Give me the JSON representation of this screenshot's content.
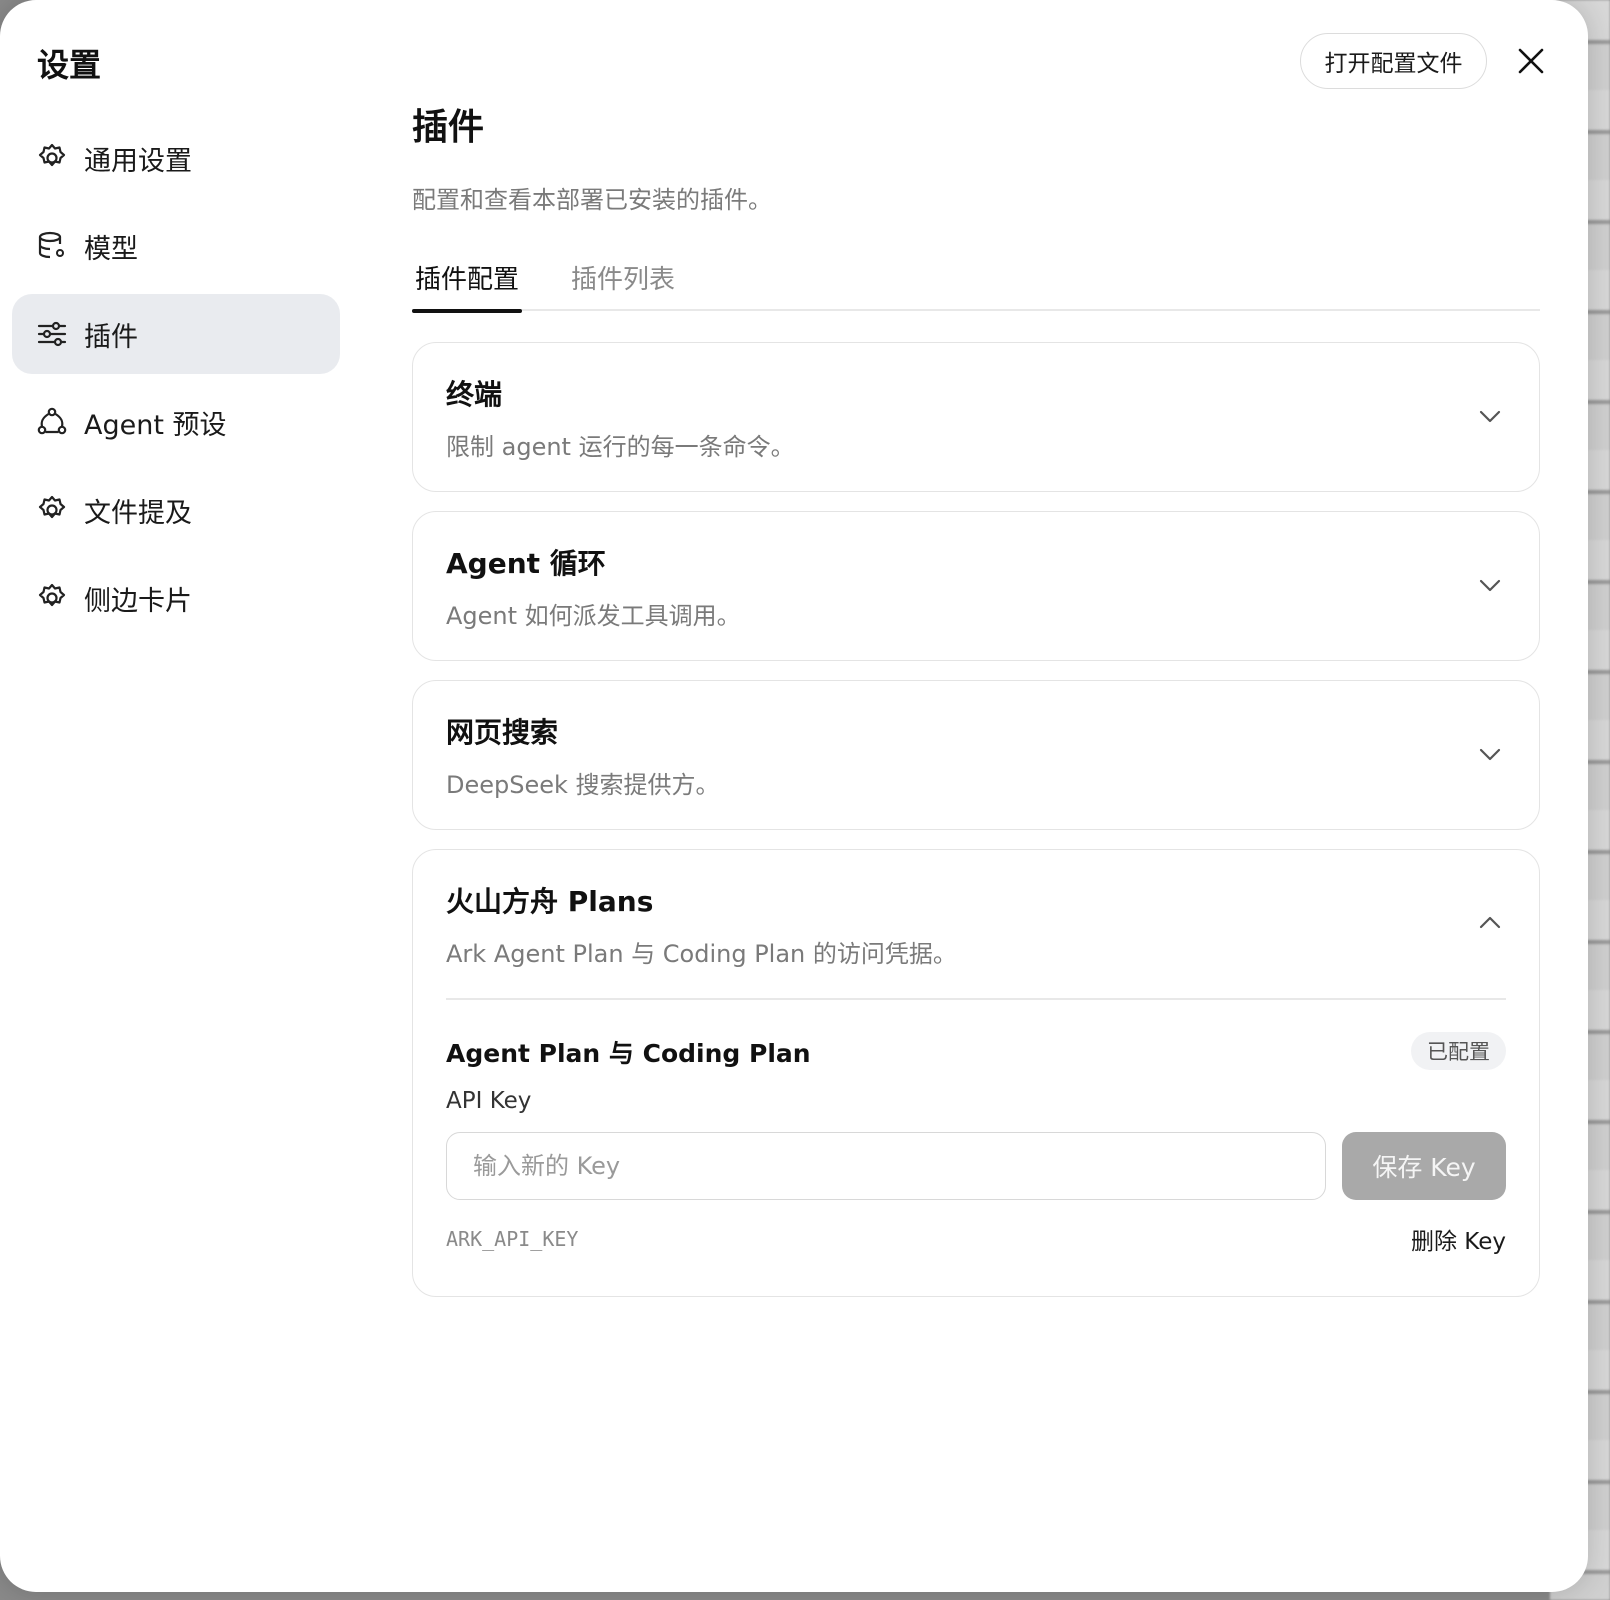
{
  "dialog": {
    "title": "设置"
  },
  "sidebar": {
    "items": [
      {
        "label": "通用设置",
        "icon": "gear-icon"
      },
      {
        "label": "模型",
        "icon": "database-gear-icon"
      },
      {
        "label": "插件",
        "icon": "sliders-icon",
        "active": true
      },
      {
        "label": "Agent 预设",
        "icon": "agent-icon"
      },
      {
        "label": "文件提及",
        "icon": "gear-icon"
      },
      {
        "label": "侧边卡片",
        "icon": "gear-icon"
      }
    ]
  },
  "header": {
    "open_config_label": "打开配置文件",
    "close_icon": "close-icon"
  },
  "main": {
    "title": "插件",
    "subtitle": "配置和查看本部署已安装的插件。",
    "tabs": [
      {
        "label": "插件配置",
        "active": true
      },
      {
        "label": "插件列表",
        "active": false
      }
    ],
    "cards": [
      {
        "title": "终端",
        "desc": "限制 agent 运行的每一条命令。",
        "expanded": false
      },
      {
        "title": "Agent 循环",
        "desc": "Agent 如何派发工具调用。",
        "expanded": false
      },
      {
        "title": "网页搜索",
        "desc": "DeepSeek 搜索提供方。",
        "expanded": false
      },
      {
        "title": "火山方舟 Plans",
        "desc": "Ark Agent Plan 与 Coding Plan 的访问凭据。",
        "expanded": true,
        "section": {
          "title": "Agent Plan 与 Coding Plan",
          "badge": "已配置",
          "field_label": "API Key",
          "input_placeholder": "输入新的 Key",
          "input_value": "",
          "save_label": "保存 Key",
          "env_name": "ARK_API_KEY",
          "delete_label": "删除 Key"
        }
      }
    ]
  },
  "colors": {
    "active_nav_bg": "#e9ebef",
    "save_button_disabled": "#a9a9a9",
    "muted_text": "#7a7a7a"
  }
}
